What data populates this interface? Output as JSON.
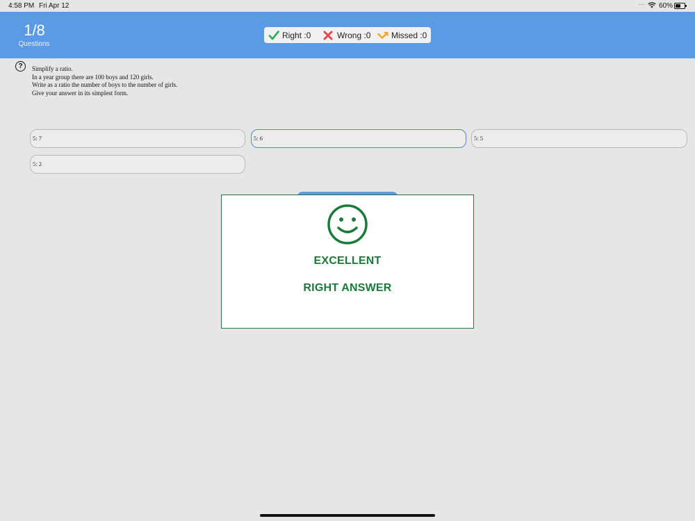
{
  "status_bar": {
    "time": "4:58 PM",
    "date": "Fri Apr 12",
    "battery": "60%"
  },
  "header": {
    "counter": "1/8",
    "counter_label": "Questions",
    "score": {
      "right": "Right :0",
      "wrong": "Wrong :0",
      "missed": "Missed :0"
    },
    "colors": {
      "bar": "#5b9be6",
      "right": "#2eaa55",
      "wrong": "#e0484f",
      "missed": "#f0a42c"
    }
  },
  "question": {
    "lines": [
      "Simplify a ratio.",
      "In a year group there are 100 boys and 120 girls.",
      "Write as a ratio the number of boys to the number of girls.",
      "Give your answer in its simplest form."
    ]
  },
  "options": [
    {
      "label": "5: 7",
      "selected": false
    },
    {
      "label": "5: 6",
      "selected": true
    },
    {
      "label": "5: 5",
      "selected": false
    },
    {
      "label": "5: 2",
      "selected": false
    }
  ],
  "modal": {
    "icon": "smiley-icon",
    "title": "EXCELLENT",
    "subtitle": "RIGHT ANSWER",
    "color": "#1b7a3a"
  }
}
